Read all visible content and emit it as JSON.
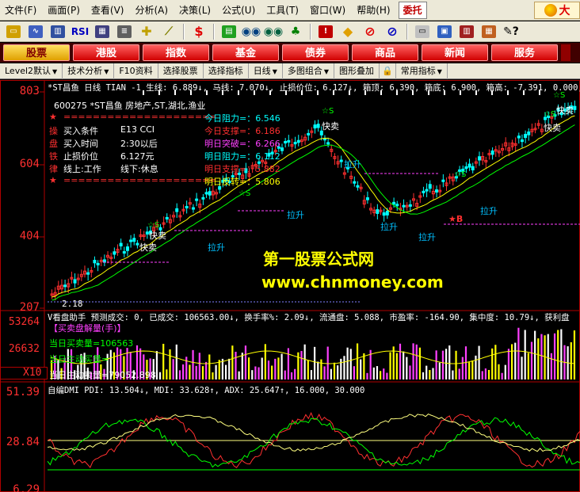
{
  "menubar": {
    "items": [
      "文件(F)",
      "画面(P)",
      "查看(V)",
      "分析(A)",
      "决策(L)",
      "公式(U)",
      "工具(T)",
      "窗口(W)",
      "帮助(H)"
    ],
    "special": "委托",
    "brand": "大"
  },
  "toolbar": {
    "icons": [
      "open-icon",
      "chart-icon",
      "bar-chart-icon",
      "rsi-icon",
      "grid-icon",
      "lines-icon",
      "pencil-icon",
      "ruler-icon",
      "dollar-icon",
      "cards-icon",
      "binoculars-icon",
      "binoculars2-icon",
      "bell-icon",
      "alert-icon",
      "diamond-icon",
      "circle-no-icon",
      "circle-no2-icon",
      "note-icon",
      "screen-icon",
      "books-icon",
      "palette-icon",
      "help-icon"
    ],
    "rsi_label": "RSI"
  },
  "tabs": [
    {
      "label": "股票",
      "active": true
    },
    {
      "label": "港股",
      "active": false
    },
    {
      "label": "指数",
      "active": false
    },
    {
      "label": "基金",
      "active": false
    },
    {
      "label": "债券",
      "active": false
    },
    {
      "label": "商品",
      "active": false
    },
    {
      "label": "新闻",
      "active": false
    },
    {
      "label": "服务",
      "active": false
    }
  ],
  "funcbar": {
    "items": [
      "Level2默认",
      "技术分析",
      "F10资料",
      "选择股票",
      "选择指标",
      "日线",
      "多图组合",
      "图形叠加",
      "常用指标"
    ]
  },
  "chart": {
    "header": "*ST昌鱼 日线 TIAN -1 生线: 6.889↓, 马线: 7.070↓, 止损价位: 6.127↓, 箱顶: 6.390, 箱底: 6.900, 箱高: -7.391, 0.000, 0.000",
    "price_axis": [
      "803",
      "604",
      "404",
      "207"
    ],
    "info_title": "600275 *ST昌鱼 房地产,ST,湖北,渔业",
    "info_rows": [
      {
        "k": "★",
        "a": "=====================",
        "b": ""
      },
      {
        "k": "操",
        "a": "买入条件",
        "b": "E13 CCI"
      },
      {
        "k": "盘",
        "a": "买入时间",
        "b": "2:30以后"
      },
      {
        "k": "铁",
        "a": "止损价位",
        "b": "6.127元"
      },
      {
        "k": "律",
        "a": "线上:工作",
        "b": "线下:休息"
      },
      {
        "k": "★",
        "a": "=====================",
        "b": ""
      }
    ],
    "right_info": [
      {
        "label": "今日阻力=",
        "value": "6.546",
        "color": "#00ffff"
      },
      {
        "label": "今日支撑=",
        "value": "6.186",
        "color": "#ff3030"
      },
      {
        "label": "明日突破=",
        "value": "6.266",
        "color": "#ff40ff"
      },
      {
        "label": "明日阻力=",
        "value": "6.112",
        "color": "#00ffff"
      },
      {
        "label": "明日支撑=",
        "value": "5.882",
        "color": "#ff3030"
      },
      {
        "label": "明日反转=",
        "value": "5.806",
        "color": "#ffff00"
      }
    ],
    "low_mark": "2.18",
    "signal_sell": "快卖",
    "signal_up": "拉升",
    "signal_star": "☆S",
    "signal_b": "B",
    "watermark1": "第一股票公式网",
    "watermark2": "www.chnmoney.com"
  },
  "volume": {
    "axis": [
      "53264",
      "26632",
      "X10"
    ],
    "header": "V看盘助手 预测成交: 0, 已成交: 106563.00↓, 换手率%: 2.09↓, 流通盘: 5.088, 市盈率: -164.90, 集中度: 10.79↓, 获利盘",
    "title": "【买卖盘解量(手)】",
    "day_buysell": "当日买卖量=106563",
    "day_active_buy": "当日主动买量=",
    "day_active_sell": "当日主动卖量=79052.898"
  },
  "dmi": {
    "axis": [
      "51.39",
      "28.84",
      "6.29"
    ],
    "header": "自编DMI  PDI: 13.504↓, MDI: 33.628↑, ADX: 25.647↑, 16.000, 30.000"
  },
  "colors": {
    "up": "#ff3030",
    "down": "#00ffff",
    "grid": "#b00000"
  }
}
